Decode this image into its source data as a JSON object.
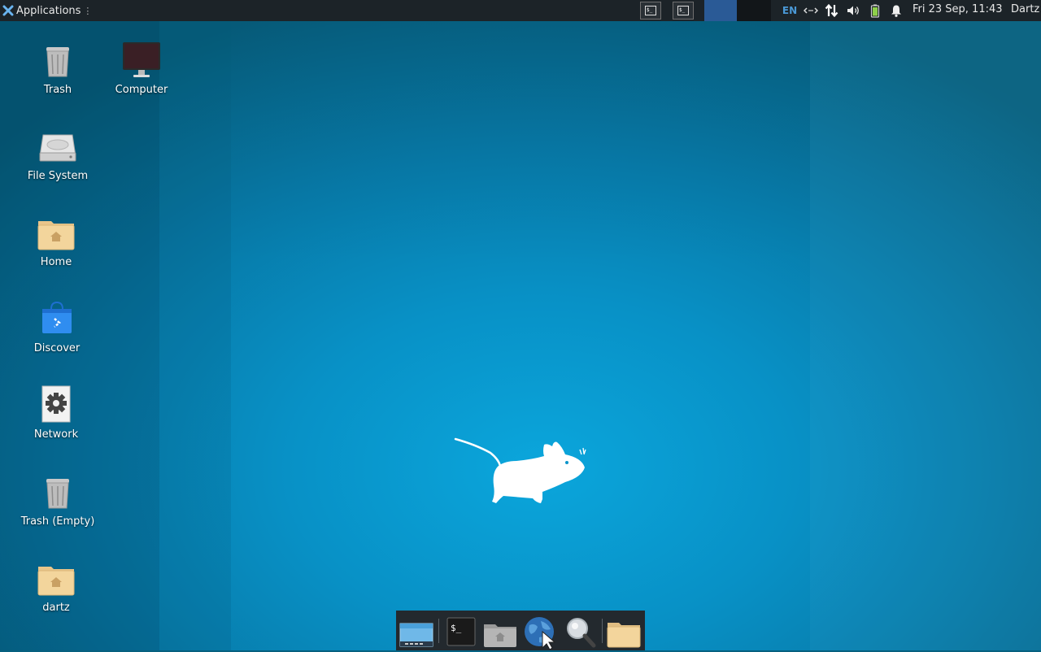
{
  "top_panel": {
    "applications_label": "Applications",
    "menu_dots": "⋮",
    "keyboard_layout": "EN",
    "clock": "Fri 23 Sep, 11:43",
    "user": "Dartz",
    "window_buttons": [
      {
        "icon": "terminal-icon",
        "glyph": "$_"
      },
      {
        "icon": "terminal-icon",
        "glyph": "$_"
      }
    ],
    "workspaces": {
      "active": 1,
      "count": 2
    },
    "tray": [
      "network-transfer-icon",
      "updown-arrows-icon",
      "volume-icon",
      "battery-icon",
      "notification-bell-icon"
    ]
  },
  "desktop": {
    "icons": [
      {
        "label": "Trash",
        "icon": "trash-icon"
      },
      {
        "label": "Computer",
        "icon": "computer-icon"
      },
      {
        "label": "File System",
        "icon": "hard-drive-icon"
      },
      {
        "label": "Home",
        "icon": "home-folder-icon"
      },
      {
        "label": "Discover",
        "icon": "discover-bag-icon"
      },
      {
        "label": "Network",
        "icon": "network-gear-icon"
      },
      {
        "label": "Trash (Empty)",
        "icon": "trash-icon"
      },
      {
        "label": "dartz",
        "icon": "home-folder-icon"
      }
    ]
  },
  "dock": {
    "items": [
      "show-desktop-icon",
      "terminal-icon",
      "file-manager-icon",
      "web-browser-icon",
      "app-finder-icon",
      "folder-icon"
    ],
    "terminal_glyph": "$_"
  },
  "colors": {
    "panel": "#1c2328",
    "wallpaper": "#0891c6",
    "workspace_active": "#2a5a96",
    "keyboard_accent": "#4a98d6"
  }
}
